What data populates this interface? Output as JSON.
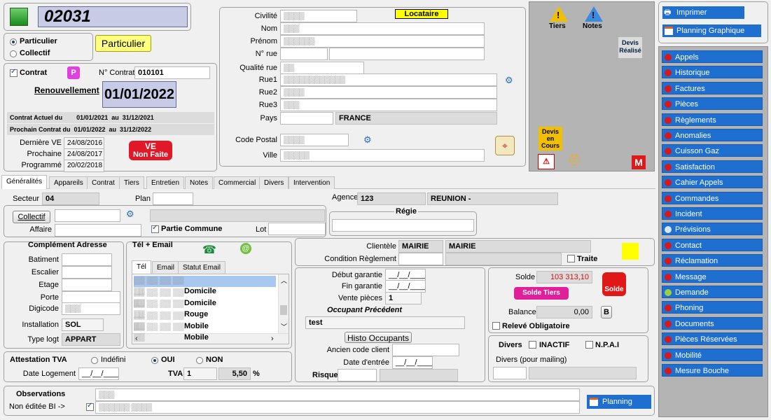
{
  "header": {
    "code": "02031"
  },
  "client_type": {
    "particulier": "Particulier",
    "collectif": "Collectif",
    "badge": "Particulier"
  },
  "contrat": {
    "label": "Contrat",
    "num_label": "N° Contrat",
    "num_value": "010101",
    "renouvellement": "Renouvellement",
    "renouvellement_date": "01/01/2022",
    "actuel": "Contrat Actuel du        01/01/2021  au  31/12/2021",
    "prochain": "Prochain Contrat du  01/01/2022  au  31/12/2022",
    "derniere_ve_label": "Dernière VE",
    "derniere_ve": "24/08/2016",
    "prochaine_label": "Prochaine",
    "prochaine": "24/08/2017",
    "programme_label": "Programmé",
    "programme": "20/02/2018",
    "ve_badge_1": "VE",
    "ve_badge_2": "Non Faite"
  },
  "identity": {
    "civilite_label": "Civilité",
    "civilite": "▒▒▒▒",
    "nom_label": "Nom",
    "nom": "▒▒▒",
    "prenom_label": "Prénom",
    "prenom": "▒▒▒▒▒▒",
    "nrue_label": "N° rue",
    "qualite_label": "Qualité rue",
    "qualite": "▒▒",
    "rue1_label": "Rue1",
    "rue1": "▒▒▒▒▒▒▒▒▒▒▒▒",
    "rue2_label": "Rue2",
    "rue2": "▒▒▒▒",
    "rue3_label": "Rue3",
    "rue3": "▒▒▒",
    "pays_label": "Pays",
    "pays": "FRANCE",
    "cp_label": "Code Postal",
    "cp": "▒▒▒▒",
    "ville_label": "Ville",
    "ville": "▒▒▒▒▒",
    "locataire": "Locataire"
  },
  "alerts": {
    "tiers": "Tiers",
    "notes": "Notes",
    "devis_realise_1": "Devis",
    "devis_realise_2": "Réalisé",
    "devis_cours_1": "Devis",
    "devis_cours_2": "en",
    "devis_cours_3": "Cours",
    "m": "M"
  },
  "sidebar": {
    "imprimer": "Imprimer",
    "planning_graphique": "Planning Graphique",
    "items": [
      "Appels",
      "Historique",
      "Factures",
      "Pièces",
      "Règlements",
      "Anomalies",
      "Cuisson Gaz",
      "Satisfaction",
      "Cahier Appels",
      "Commandes",
      "Incident",
      "Prévisions",
      "Contact",
      "Réclamation",
      "Message",
      "Demande",
      "Phoning",
      "Documents",
      "Pièces Réservées",
      "Mobilité",
      "Mesure Bouche"
    ]
  },
  "tabs": [
    "Généralités",
    "Appareils",
    "Contrat",
    "Tiers",
    "Entretien",
    "Notes",
    "Commercial",
    "Divers",
    "Intervention"
  ],
  "general": {
    "secteur_label": "Secteur",
    "secteur": "04",
    "plan_label": "Plan",
    "agence_label": "Agence",
    "agence": "123",
    "agence_name": "REUNION -",
    "collectif_btn": "Collectif",
    "affaire_label": "Affaire",
    "partie_commune": "Partie Commune",
    "lot_label": "Lot",
    "regie": "Régie"
  },
  "complement": {
    "title": "Complément Adresse",
    "batiment": "Batiment",
    "escalier": "Escalier",
    "etage": "Etage",
    "porte": "Porte",
    "digicode": "Digicode",
    "digicode_val": "▒▒▒",
    "installation_label": "Installation",
    "installation": "SOL",
    "type_label": "Type logt",
    "type": "APPART"
  },
  "tel": {
    "title": "Tél + Email",
    "tabs": [
      "Tél",
      "Email",
      "Statut Email"
    ],
    "rows": [
      {
        "num": "▒▒ ▒▒ ▒▒ ▒▒ ▒▒",
        "type": "Domicile"
      },
      {
        "num": "▒▒ ▒▒ ▒▒ ▒▒ ▒▒",
        "type": "Domicile"
      },
      {
        "num": "▒▒ ▒▒ ▒▒ ▒▒ ▒▒",
        "type": "Rouge"
      },
      {
        "num": "▒▒ ▒▒ ▒▒ ▒▒ ▒▒",
        "type": "Mobile"
      },
      {
        "num": "▒▒ ▒▒ ▒▒ ▒▒ ▒▒",
        "type": "Mobile"
      }
    ]
  },
  "clientele": {
    "label": "Clientèle",
    "code": "MAIRIE",
    "name": "MAIRIE",
    "condition_label": "Condition Règlement",
    "traite": "Traite"
  },
  "garantie": {
    "debut_label": "Début garantie",
    "debut": "__/__/____",
    "fin_label": "Fin garantie",
    "fin": "__/__/____",
    "vente_label": "Vente pièces",
    "vente": "1",
    "occupant_label": "Occupant Précédent",
    "occupant": "test",
    "histo_btn": "Histo Occupants",
    "ancien_label": "Ancien code client",
    "date_entree_label": "Date d'entrée",
    "date_entree": "__/__/____",
    "risque_label": "Risque"
  },
  "solde": {
    "label": "Solde",
    "value": "103 313,10",
    "solde_tiers_btn": "Solde Tiers",
    "solde_btn": "Solde",
    "balance_label": "Balance",
    "balance": "0,00",
    "b_btn": "B",
    "releve": "Relevé Obligatoire"
  },
  "divers": {
    "label": "Divers",
    "inactif": "INACTIF",
    "npai": "N.P.A.I",
    "mailing": "Divers (pour mailing)"
  },
  "tva": {
    "title": "Attestation TVA",
    "indefini": "Indéfini",
    "oui": "OUI",
    "non": "NON",
    "date_label": "Date Logement",
    "date": "__/__/____",
    "tva_label": "TVA",
    "tva_code": "1",
    "tva_rate": "5,50",
    "pct": "%"
  },
  "observations": {
    "label": "Observations",
    "non_editee": "Non éditée BI ->",
    "obs_val": "▒▒▒",
    "bi_val": "▒▒▒▒▒▒ ▒▒▒▒",
    "planning": "Planning"
  }
}
